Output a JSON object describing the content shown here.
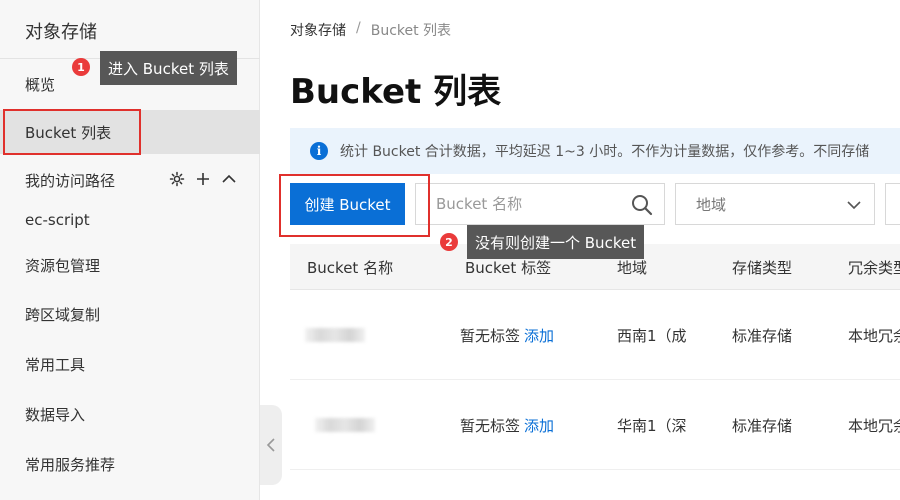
{
  "sidebar": {
    "title": "对象存储",
    "items": [
      {
        "label": "概览"
      },
      {
        "label": "Bucket 列表"
      }
    ],
    "group_label": "我的访问路径",
    "sub_items": [
      {
        "label": "ec-script"
      },
      {
        "label": "资源包管理"
      },
      {
        "label": "跨区域复制"
      },
      {
        "label": "常用工具"
      },
      {
        "label": "数据导入"
      },
      {
        "label": "常用服务推荐"
      }
    ]
  },
  "breadcrumb": {
    "root": "对象存储",
    "separator": "/",
    "current": "Bucket 列表"
  },
  "page": {
    "title": "Bucket 列表",
    "info_text": "统计 Bucket 合计数据，平均延迟 1~3 小时。不作为计量数据，仅作参考。不同存储"
  },
  "toolbar": {
    "create_label": "创建 Bucket",
    "search_placeholder": "Bucket 名称",
    "region_placeholder": "地域"
  },
  "table": {
    "headers": [
      "Bucket 名称",
      "Bucket 标签",
      "地域",
      "存储类型",
      "冗余类型"
    ],
    "rows": [
      {
        "tag_text": "暂无标签",
        "tag_link": "添加",
        "region": "西南1（成",
        "storage": "标准存储",
        "redundancy": "本地冗余"
      },
      {
        "tag_text": "暂无标签",
        "tag_link": "添加",
        "region": "华南1（深",
        "storage": "标准存储",
        "redundancy": "本地冗余"
      }
    ]
  },
  "annotations": [
    {
      "number": "1",
      "text": "进入 Bucket 列表"
    },
    {
      "number": "2",
      "text": "没有则创建一个 Bucket"
    }
  ],
  "colors": {
    "primary": "#0a6fd6",
    "highlight": "#e0302c",
    "badge": "#ea3b3b",
    "tooltip_bg": "#575757",
    "info_bg": "#eaf3fc"
  }
}
